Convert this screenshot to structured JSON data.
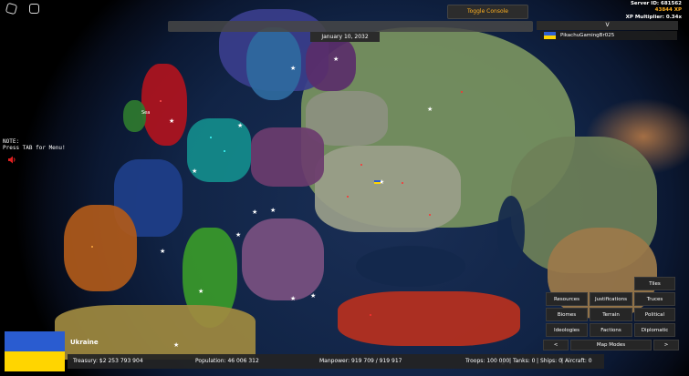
{
  "top": {
    "toggle_console_label": "Toggle Console",
    "server_id": "Server ID: 681562",
    "xp": "43844 XP",
    "xp_multiplier": "XP Multiplier: 0.34x",
    "date": "January 10, 2032",
    "dropdown_label": "V",
    "player_name": "PikachuGamingBr025"
  },
  "sidebar": {
    "note_text": "NOTE:\nPress TAB for Menu!"
  },
  "map": {
    "sea_label": "Sea"
  },
  "country": {
    "name": "Ukraine",
    "flag_colors": [
      "#2a5cd0",
      "#ffd500"
    ]
  },
  "stats": {
    "treasury": "Treasury: $2 253 793 904",
    "population": "Population: 46 006 312",
    "manpower": "Manpower: 919 709 / 919 917",
    "troops": "Troops: 100 000",
    "tanks": "Tanks: 0",
    "ships": "Ships: 0",
    "aircraft": "Aircraft: 0"
  },
  "map_modes": {
    "tiles": "Tiles",
    "resources": "Resources",
    "justifications": "Justifications",
    "truces": "Truces",
    "biomes": "Biomes",
    "terrain": "Terrain",
    "political": "Political",
    "ideologies": "Ideologies",
    "factions": "Factions",
    "diplomatic": "Diplomatic",
    "prev": "<",
    "label": "Map Modes",
    "next": ">"
  },
  "colors": {
    "accent_orange": "#ffb020",
    "ui_dark": "#262626"
  }
}
